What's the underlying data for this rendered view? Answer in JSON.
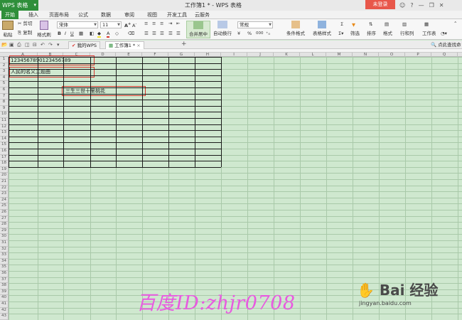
{
  "app": {
    "name": "WPS 表格",
    "window_title": "工作簿1 * - WPS 表格",
    "login": "未登录"
  },
  "menu": {
    "tabs": [
      "开始",
      "插入",
      "页面布局",
      "公式",
      "数据",
      "审阅",
      "视图",
      "开发工具",
      "云服务"
    ]
  },
  "ribbon": {
    "paste": "粘贴",
    "cut": "剪切",
    "copy": "复制",
    "format_painter": "格式刷",
    "font_name": "宋体",
    "font_size": "11",
    "merge_center": "合并居中",
    "wrap_text": "自动换行",
    "number_format": "常规",
    "conditional_format": "条件格式",
    "table_style": "表格样式",
    "filter": "筛选",
    "sort": "排序",
    "format": "格式",
    "row_col": "行和列",
    "worksheet": "工作表",
    "percent": "%",
    "thousands": "000"
  },
  "tabs": {
    "my_wps": "我的WPS",
    "workbook": "工作簿1 *",
    "search_placeholder": "点此查找命"
  },
  "sheet": {
    "columns": [
      "A",
      "B",
      "C",
      "D",
      "E",
      "F",
      "G",
      "H",
      "I",
      "J",
      "K",
      "L",
      "M",
      "N",
      "O",
      "P",
      "Q"
    ],
    "rows": [
      "1",
      "2",
      "3",
      "4",
      "5",
      "6",
      "7",
      "8",
      "9",
      "10",
      "11",
      "12",
      "13",
      "14",
      "15",
      "16",
      "17",
      "18",
      "19",
      "20",
      "21",
      "22",
      "23",
      "24",
      "25",
      "26",
      "27",
      "28",
      "29",
      "30",
      "31",
      "32",
      "33",
      "34",
      "35",
      "36",
      "37",
      "38",
      "39",
      "40",
      "41",
      "42",
      "43"
    ],
    "cells": {
      "A1": "123456789012345678​9",
      "A3": "人民的名义主题曲",
      "C6": "三生三世十里桃花"
    }
  },
  "watermark": {
    "text": "百度ID:zhjr0708",
    "logo": "Bai 经验",
    "site": "jingyan.baidu.com"
  },
  "colors": {
    "accent_green": "#2f8f3a",
    "sheet_bg": "#cfe8cf",
    "highlight_red": "#d9342b",
    "watermark_pink": "#e85ae0",
    "login_red": "#e8574a"
  }
}
